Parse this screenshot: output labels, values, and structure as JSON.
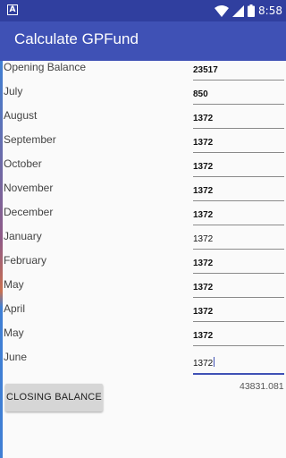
{
  "status_bar": {
    "time": "8:58",
    "left_icon": "A",
    "icons": [
      "wifi-icon",
      "signal-icon",
      "battery-icon"
    ]
  },
  "app_bar": {
    "title": "Calculate GPFund",
    "color": "#3f51b5"
  },
  "rows": [
    {
      "label": "Opening Balance",
      "value": "23517"
    },
    {
      "label": "July",
      "value": "850"
    },
    {
      "label": "August",
      "value": "1372"
    },
    {
      "label": "September",
      "value": "1372"
    },
    {
      "label": "October",
      "value": "1372"
    },
    {
      "label": "November",
      "value": "1372"
    },
    {
      "label": "December",
      "value": "1372"
    },
    {
      "label": "January",
      "value": "1372"
    },
    {
      "label": "February",
      "value": "1372"
    },
    {
      "label": "May",
      "value": "1372"
    },
    {
      "label": "April",
      "value": "1372"
    },
    {
      "label": "May",
      "value": "1372"
    },
    {
      "label": "June",
      "value": "1372"
    }
  ],
  "button": {
    "label": "CLOSING BALANCE"
  },
  "result": "43831.081"
}
